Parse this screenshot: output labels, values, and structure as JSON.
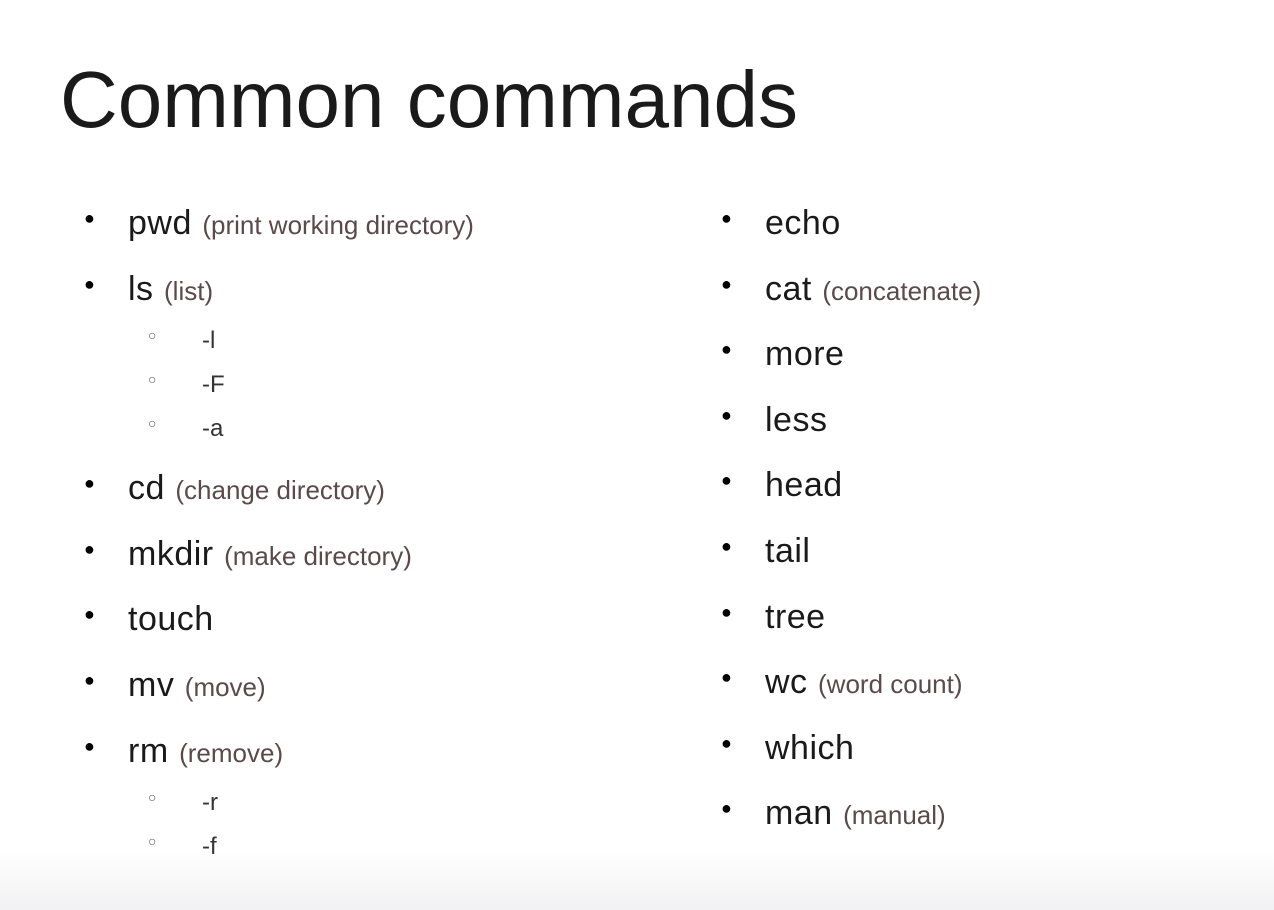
{
  "title": "Common commands",
  "left": [
    {
      "cmd": "pwd",
      "desc": "(print working directory)"
    },
    {
      "cmd": "ls",
      "desc": "(list)",
      "sub": [
        "-l",
        "-F",
        "-a"
      ]
    },
    {
      "cmd": "cd",
      "desc": "(change directory)"
    },
    {
      "cmd": "mkdir",
      "desc": "(make directory)"
    },
    {
      "cmd": "touch",
      "desc": ""
    },
    {
      "cmd": "mv",
      "desc": "(move)"
    },
    {
      "cmd": "rm",
      "desc": "(remove)",
      "sub": [
        "-r",
        "-f"
      ]
    }
  ],
  "right": [
    {
      "cmd": "echo",
      "desc": ""
    },
    {
      "cmd": "cat",
      "desc": "(concatenate)"
    },
    {
      "cmd": "more",
      "desc": ""
    },
    {
      "cmd": "less",
      "desc": ""
    },
    {
      "cmd": "head",
      "desc": ""
    },
    {
      "cmd": "tail",
      "desc": ""
    },
    {
      "cmd": "tree",
      "desc": ""
    },
    {
      "cmd": "wc",
      "desc": "(word count)"
    },
    {
      "cmd": "which",
      "desc": ""
    },
    {
      "cmd": "man",
      "desc": "(manual)"
    }
  ]
}
